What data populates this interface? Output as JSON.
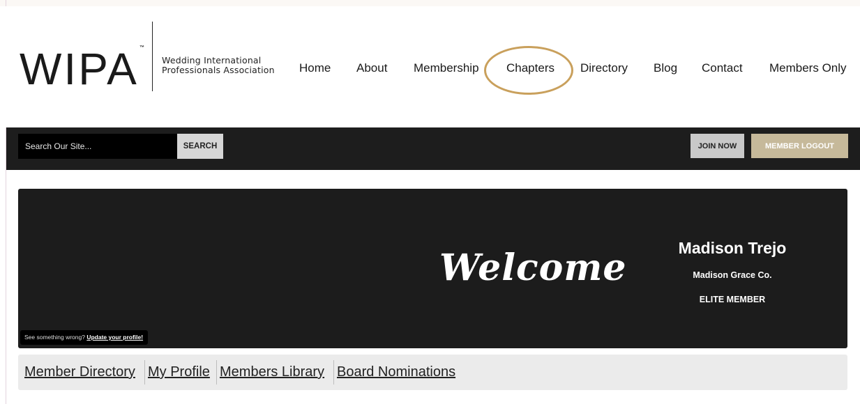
{
  "brand": {
    "logo_text": "WIPA",
    "trademark": "™",
    "tagline_line1": "Wedding International",
    "tagline_line2": "Professionals Association"
  },
  "nav": {
    "items": [
      {
        "label": "Home"
      },
      {
        "label": "About"
      },
      {
        "label": "Membership"
      },
      {
        "label": "Chapters"
      },
      {
        "label": "Directory"
      },
      {
        "label": "Blog"
      },
      {
        "label": "Contact"
      },
      {
        "label": "Members Only"
      }
    ],
    "highlighted_item": "Chapters",
    "highlight_color": "#c9a05c"
  },
  "toolbar": {
    "search_placeholder": "Search Our Site...",
    "search_button": "SEARCH",
    "join_button": "JOIN NOW",
    "logout_button": "MEMBER LOGOUT",
    "logout_color": "#c6b99a"
  },
  "welcome": {
    "heading": "Welcome",
    "member_name": "Madison Trejo",
    "company": "Madison Grace Co.",
    "level": "ELITE MEMBER",
    "notice_text": "See something wrong? ",
    "notice_link": "Update your profile!"
  },
  "member_nav": {
    "items": [
      {
        "label": "Member Directory"
      },
      {
        "label": "My Profile"
      },
      {
        "label": "Members Library"
      },
      {
        "label": "Board Nominations"
      }
    ]
  }
}
